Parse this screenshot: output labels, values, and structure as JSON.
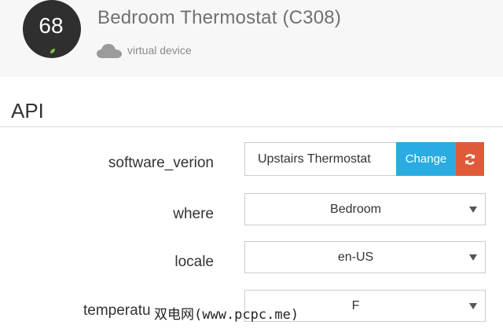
{
  "device": {
    "temperature": "68",
    "title": "Bedroom Thermostat (C308)",
    "subtitle": "virtual device",
    "icons": {
      "status": "leaf-icon",
      "cloud": "cloud-icon"
    }
  },
  "section": {
    "title": "API"
  },
  "fields": {
    "software_version": {
      "label": "software_verion",
      "value": "Upstairs Thermostat",
      "change_label": "Change",
      "refresh_icon": "refresh-icon"
    },
    "where": {
      "label": "where",
      "value": "Bedroom"
    },
    "locale": {
      "label": "locale",
      "value": "en-US"
    },
    "temperature_scale": {
      "label": "temperatu",
      "value": "F"
    }
  },
  "watermark": "双电网(www.pcpc.me)",
  "colors": {
    "accent": "#2aabe2",
    "refresh": "#e05a3a",
    "thermostat": "#2f2f2f",
    "leaf": "#7dc242"
  }
}
